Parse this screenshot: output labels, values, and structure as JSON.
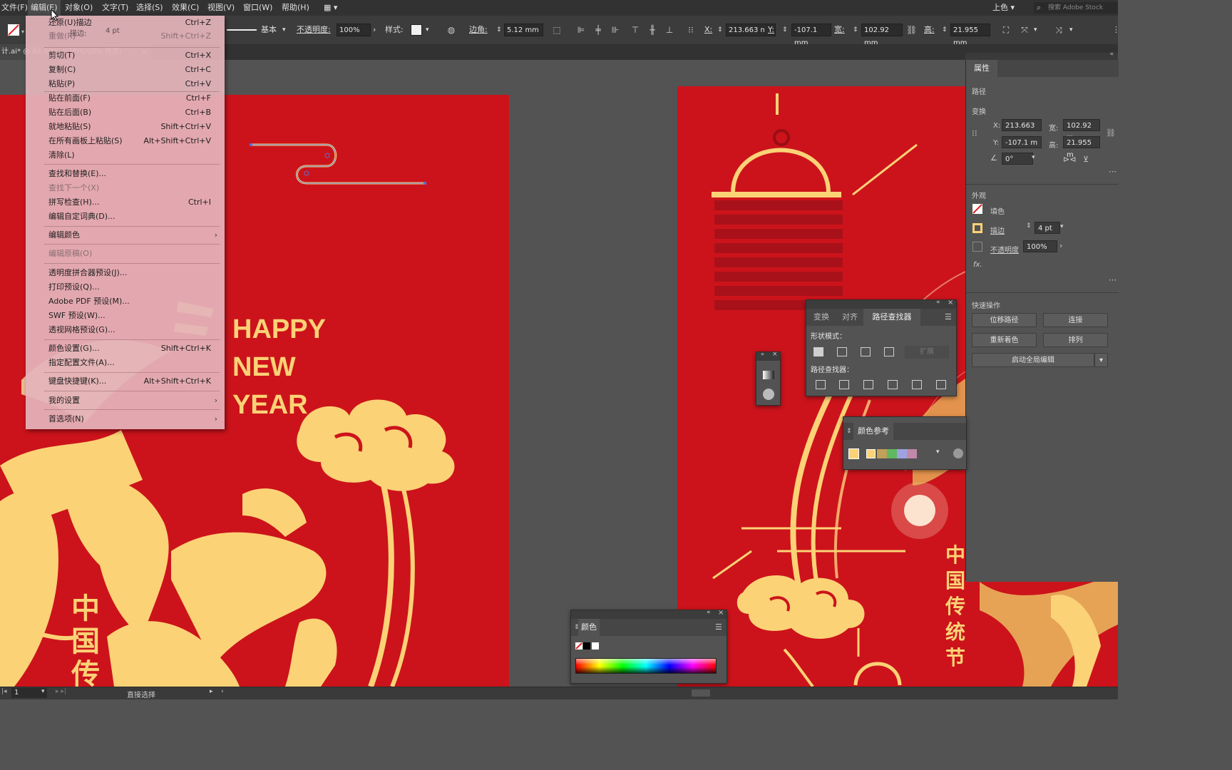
{
  "menubar": {
    "items": [
      "文件(F)",
      "编辑(E)",
      "对象(O)",
      "文字(T)",
      "选择(S)",
      "效果(C)",
      "视图(V)",
      "窗口(W)",
      "帮助(H)"
    ],
    "workspace": "上色",
    "search_placeholder": "搜索 Adobe Stock"
  },
  "control_bar": {
    "stroke_label": "描边",
    "stroke_value": "4 pt",
    "stroke_menu_label": "等比",
    "profile_label": "基本",
    "opacity_label": "不透明度",
    "opacity_value": "100%",
    "style_label": "样式",
    "corner_label": "边角",
    "corner_value": "5.12 mm",
    "x_label": "X",
    "x_value": "213.663 n",
    "y_label": "Y",
    "y_value": "-107.1 mm",
    "w_label": "宽",
    "w_value": "102.92 mm",
    "h_label": "高",
    "h_value": "21.955 mm"
  },
  "doc_tab": {
    "title": "计.ai* @ 64.84% (CMYK/GPU 预览)",
    "close": "×"
  },
  "edit_menu": {
    "items": [
      {
        "label": "还原(U)描边",
        "shortcut": "Ctrl+Z",
        "disabled": false
      },
      {
        "label": "重做(R)",
        "shortcut": "Shift+Ctrl+Z",
        "disabled": true
      },
      {
        "label": "剪切(T)",
        "shortcut": "Ctrl+X",
        "disabled": false
      },
      {
        "label": "复制(C)",
        "shortcut": "Ctrl+C",
        "disabled": false
      },
      {
        "label": "粘贴(P)",
        "shortcut": "Ctrl+V",
        "disabled": false
      },
      {
        "label": "贴在前面(F)",
        "shortcut": "Ctrl+F",
        "disabled": false
      },
      {
        "label": "贴在后面(B)",
        "shortcut": "Ctrl+B",
        "disabled": false
      },
      {
        "label": "就地粘贴(S)",
        "shortcut": "Shift+Ctrl+V",
        "disabled": false
      },
      {
        "label": "在所有画板上粘贴(S)",
        "shortcut": "Alt+Shift+Ctrl+V",
        "disabled": false
      },
      {
        "label": "清除(L)",
        "shortcut": "",
        "disabled": false
      },
      {
        "label": "查找和替换(E)...",
        "shortcut": "",
        "disabled": false
      },
      {
        "label": "查找下一个(X)",
        "shortcut": "",
        "disabled": true
      },
      {
        "label": "拼写检查(H)...",
        "shortcut": "Ctrl+I",
        "disabled": false
      },
      {
        "label": "编辑自定词典(D)...",
        "shortcut": "",
        "disabled": false
      },
      {
        "label": "编辑颜色",
        "shortcut": "",
        "disabled": false,
        "submenu": true
      },
      {
        "label": "编辑原稿(O)",
        "shortcut": "",
        "disabled": true
      },
      {
        "label": "透明度拼合器预设(J)...",
        "shortcut": "",
        "disabled": false
      },
      {
        "label": "打印预设(Q)...",
        "shortcut": "",
        "disabled": false
      },
      {
        "label": "Adobe PDF 预设(M)...",
        "shortcut": "",
        "disabled": false
      },
      {
        "label": "SWF 预设(W)...",
        "shortcut": "",
        "disabled": false
      },
      {
        "label": "透视网格预设(G)...",
        "shortcut": "",
        "disabled": false
      },
      {
        "label": "颜色设置(G)...",
        "shortcut": "Shift+Ctrl+K",
        "disabled": false
      },
      {
        "label": "指定配置文件(A)...",
        "shortcut": "",
        "disabled": false
      },
      {
        "label": "键盘快捷键(K)...",
        "shortcut": "Alt+Shift+Ctrl+K",
        "disabled": false
      },
      {
        "label": "我的设置",
        "shortcut": "",
        "disabled": false,
        "submenu": true
      },
      {
        "label": "首选项(N)",
        "shortcut": "",
        "disabled": false,
        "submenu": true
      }
    ],
    "submenu_arrow": "›"
  },
  "artboard_left": {
    "happy": "HAPPY",
    "new": "NEW",
    "year": "YEAR",
    "vertical_text": [
      "中",
      "国",
      "传"
    ]
  },
  "artboard_right": {
    "vertical_text": [
      "中",
      "国",
      "传",
      "统",
      "节"
    ]
  },
  "properties_panel": {
    "tab": "属性",
    "path_label": "路径",
    "transform_label": "变换",
    "x_label": "X:",
    "x_value": "213.663",
    "w_label": "宽:",
    "w_value": "102.92 m",
    "y_label": "Y:",
    "y_value": "-107.1 m",
    "h_label": "高:",
    "h_value": "21.955 m",
    "angle_value": "0°",
    "appearance_label": "外观",
    "fill_label": "填色",
    "stroke_label": "描边",
    "stroke_value": "4 pt",
    "opacity_label": "不透明度",
    "opacity_value": "100%",
    "fx_label": "fx.",
    "quick_actions_label": "快速操作",
    "btn_offset": "位移路径",
    "btn_join": "连接",
    "btn_recolor": "重新着色",
    "btn_arrange": "排列",
    "btn_global_edit": "启动全局编辑"
  },
  "pathfinder_panel": {
    "tabs": [
      "变换",
      "对齐",
      "路径查找器"
    ],
    "shape_modes_label": "形状模式：",
    "expand_label": "扩展",
    "pathfinders_label": "路径查找器："
  },
  "color_guide_panel": {
    "title": "颜色参考"
  },
  "color_panel": {
    "title": "颜色"
  },
  "status_bar": {
    "page": "1",
    "tool": "直接选择"
  },
  "colors": {
    "artboard_red": "#cc131b",
    "gold": "#fbd276",
    "menu_bg": "#e4b4ba"
  }
}
